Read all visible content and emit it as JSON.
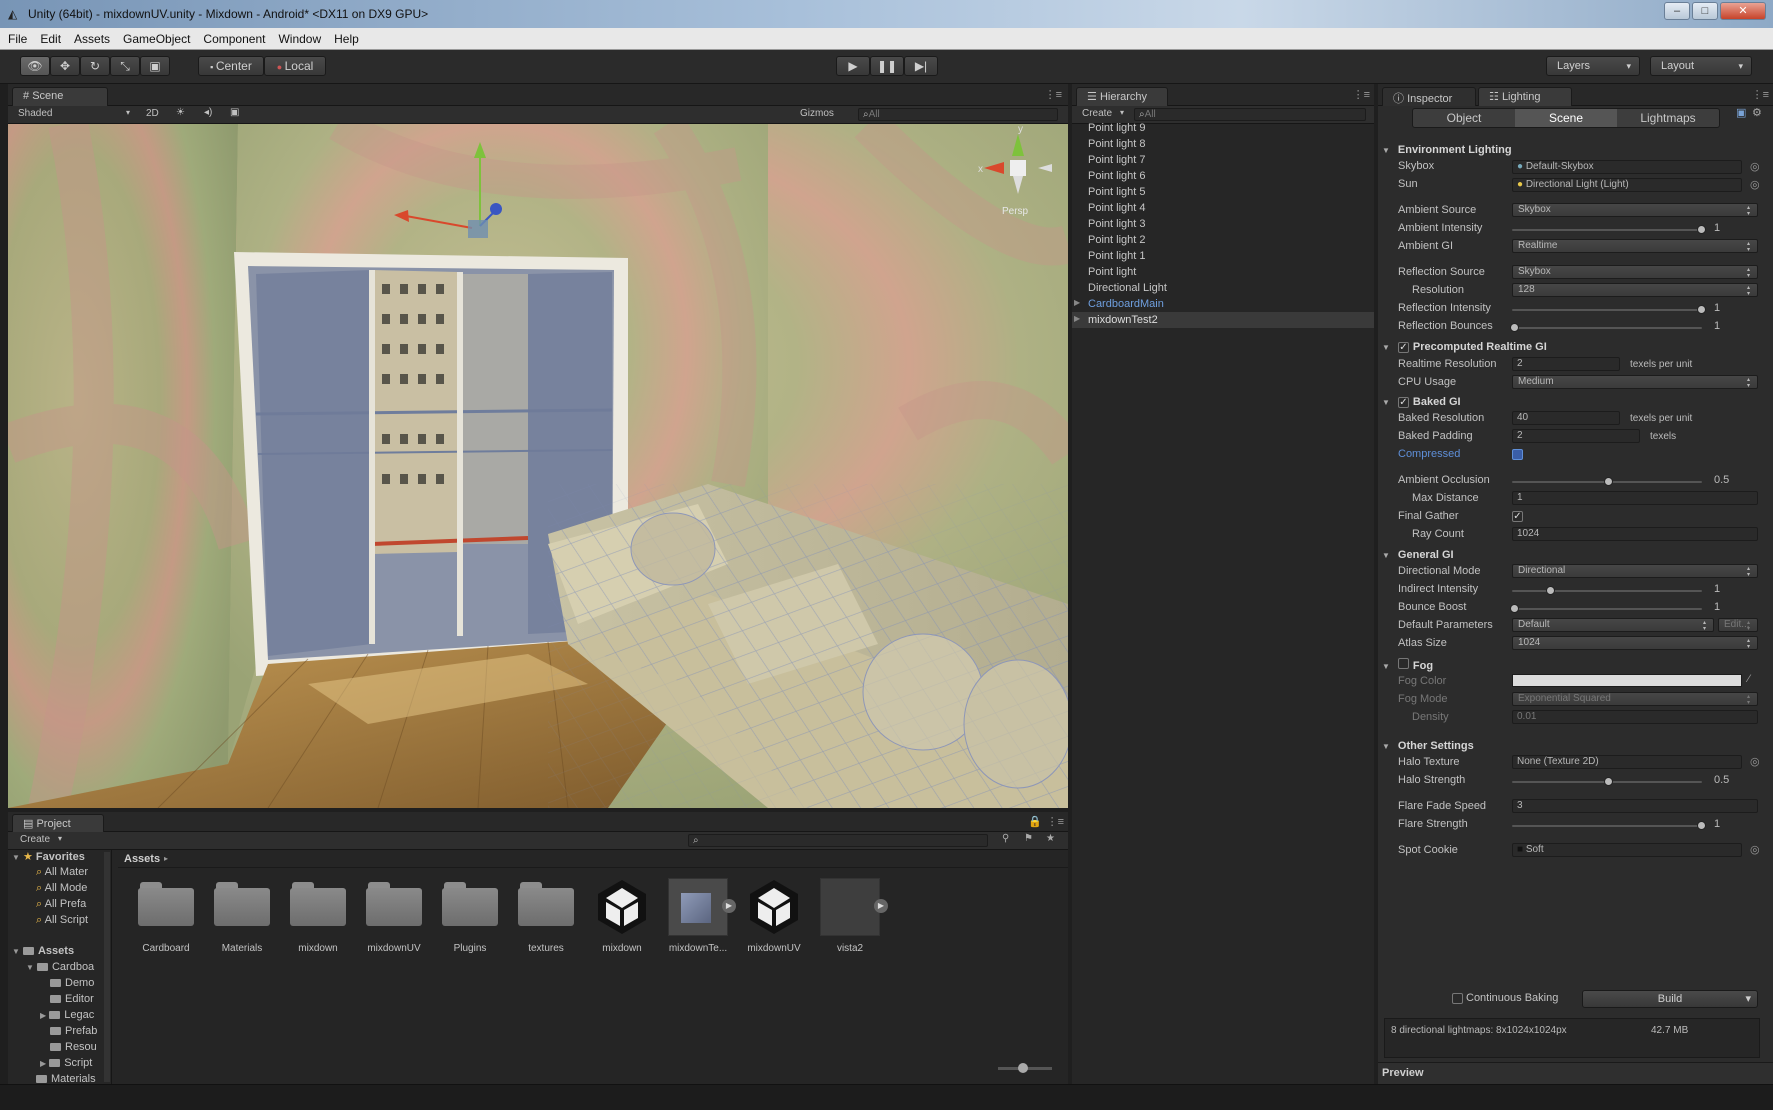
{
  "window": {
    "title": "Unity (64bit) - mixdownUV.unity - Mixdown - Android* <DX11 on DX9 GPU>"
  },
  "menu": [
    "File",
    "Edit",
    "Assets",
    "GameObject",
    "Component",
    "Window",
    "Help"
  ],
  "toolbar": {
    "pivot": "Center",
    "space": "Local",
    "layers": "Layers",
    "layout": "Layout"
  },
  "scene": {
    "tab": "Scene",
    "shading": "Shaded",
    "mode2d": "2D",
    "gizmos": "Gizmos",
    "search_placeholder": "All",
    "persp": "Persp",
    "axis_x": "x",
    "axis_y": "y"
  },
  "hierarchy": {
    "tab": "Hierarchy",
    "create": "Create",
    "search_placeholder": "All",
    "items": [
      "Point light 9",
      "Point light 8",
      "Point light 7",
      "Point light 6",
      "Point light 5",
      "Point light 4",
      "Point light 3",
      "Point light 2",
      "Point light 1",
      "Point light",
      "Directional Light",
      "CardboardMain",
      "mixdownTest2"
    ]
  },
  "inspector": {
    "tabs": [
      "Inspector",
      "Lighting"
    ],
    "subtabs": [
      "Object",
      "Scene",
      "Lightmaps"
    ],
    "environment": {
      "title": "Environment Lighting",
      "skybox_label": "Skybox",
      "skybox_value": "Default-Skybox",
      "sun_label": "Sun",
      "sun_value": "Directional Light (Light)",
      "ambient_source_label": "Ambient Source",
      "ambient_source_value": "Skybox",
      "ambient_intensity_label": "Ambient Intensity",
      "ambient_intensity_value": "1",
      "ambient_gi_label": "Ambient GI",
      "ambient_gi_value": "Realtime",
      "reflection_source_label": "Reflection Source",
      "reflection_source_value": "Skybox",
      "resolution_label": "Resolution",
      "resolution_value": "128",
      "reflection_intensity_label": "Reflection Intensity",
      "reflection_intensity_value": "1",
      "reflection_bounces_label": "Reflection Bounces",
      "reflection_bounces_value": "1"
    },
    "realtime": {
      "title": "Precomputed Realtime GI",
      "res_label": "Realtime Resolution",
      "res_value": "2",
      "res_unit": "texels per unit",
      "cpu_label": "CPU Usage",
      "cpu_value": "Medium"
    },
    "baked": {
      "title": "Baked GI",
      "res_label": "Baked Resolution",
      "res_value": "40",
      "res_unit": "texels per unit",
      "padding_label": "Baked Padding",
      "padding_value": "2",
      "padding_unit": "texels",
      "compressed_label": "Compressed",
      "ao_label": "Ambient Occlusion",
      "ao_value": "0.5",
      "maxdist_label": "Max Distance",
      "maxdist_value": "1",
      "final_gather_label": "Final Gather",
      "ray_count_label": "Ray Count",
      "ray_count_value": "1024"
    },
    "general": {
      "title": "General GI",
      "dirmode_label": "Directional Mode",
      "dirmode_value": "Directional",
      "indirect_label": "Indirect Intensity",
      "indirect_value": "1",
      "bounce_label": "Bounce Boost",
      "bounce_value": "1",
      "defparams_label": "Default Parameters",
      "defparams_value": "Default",
      "edit_label": "Edit...",
      "atlas_label": "Atlas Size",
      "atlas_value": "1024"
    },
    "fog": {
      "title": "Fog",
      "color_label": "Fog Color",
      "mode_label": "Fog Mode",
      "mode_value": "Exponential Squared",
      "density_label": "Density",
      "density_value": "0.01"
    },
    "other": {
      "title": "Other Settings",
      "halo_tex_label": "Halo Texture",
      "halo_tex_value": "None (Texture 2D)",
      "halo_str_label": "Halo Strength",
      "halo_str_value": "0.5",
      "flare_fade_label": "Flare Fade Speed",
      "flare_fade_value": "3",
      "flare_str_label": "Flare Strength",
      "flare_str_value": "1",
      "spot_cookie_label": "Spot Cookie",
      "spot_cookie_value": "Soft"
    },
    "continuous_baking": "Continuous Baking",
    "build": "Build",
    "lightmap_info": "8 directional lightmaps: 8x1024x1024px",
    "lightmap_size": "42.7 MB",
    "preview": "Preview"
  },
  "project": {
    "tab": "Project",
    "create": "Create",
    "favorites_label": "Favorites",
    "favorites": [
      "All Mater",
      "All Mode",
      "All Prefa",
      "All Script"
    ],
    "assets_label": "Assets",
    "assets_tree": [
      "Cardboa",
      "Demo",
      "Editor",
      "Legac",
      "Prefab",
      "Resou",
      "Script",
      "Materials"
    ],
    "breadcrumb": "Assets",
    "items": [
      {
        "name": "Cardboard",
        "type": "folder"
      },
      {
        "name": "Materials",
        "type": "folder"
      },
      {
        "name": "mixdown",
        "type": "folder"
      },
      {
        "name": "mixdownUV",
        "type": "folder"
      },
      {
        "name": "Plugins",
        "type": "folder"
      },
      {
        "name": "textures",
        "type": "folder"
      },
      {
        "name": "mixdown",
        "type": "unity-scene"
      },
      {
        "name": "mixdownTe...",
        "type": "texture"
      },
      {
        "name": "mixdownUV",
        "type": "unity-scene"
      },
      {
        "name": "vista2",
        "type": "texture"
      }
    ]
  }
}
